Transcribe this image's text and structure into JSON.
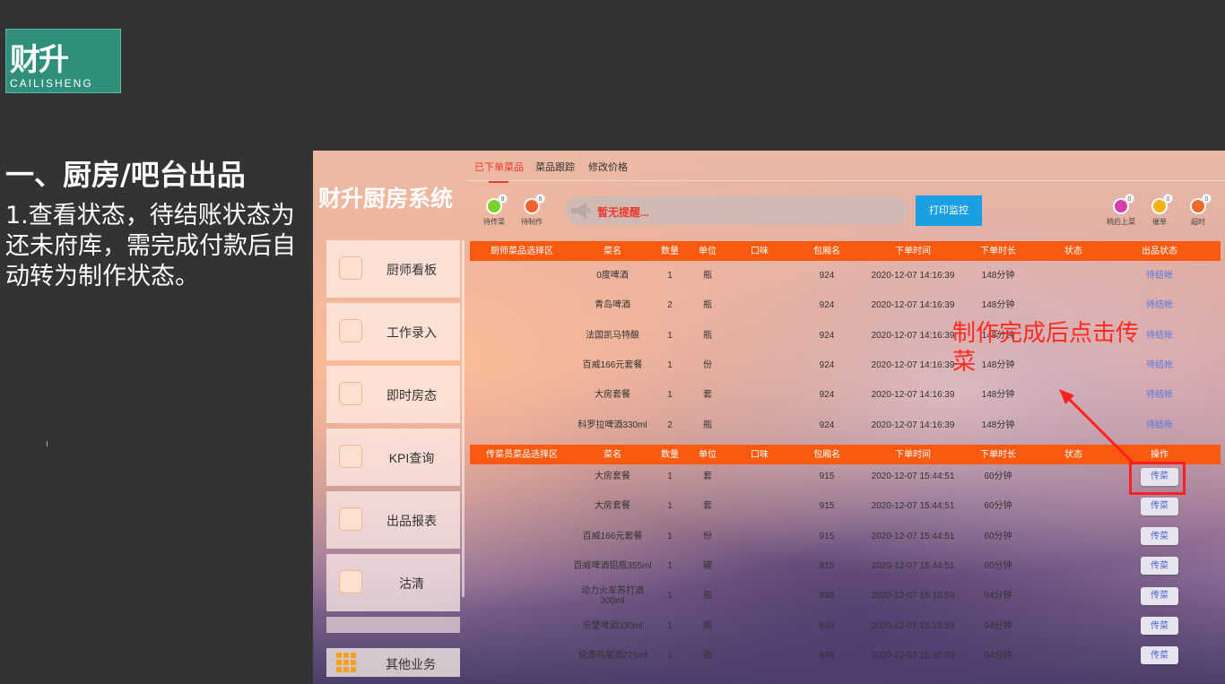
{
  "logo": {
    "main": "财升",
    "sub": "CAILISHENG"
  },
  "slide": {
    "title": "一、厨房/吧台出品",
    "desc": "1.查看状态，待结账状态为还未府库，需完成付款后自动转为制作状态。"
  },
  "app": {
    "title": "财升厨房系统",
    "tabs": [
      "已下单菜品",
      "菜品跟踪",
      "修改价格"
    ],
    "left_stats": [
      {
        "label": "待传菜",
        "count": "9",
        "color": "#7bd02b"
      },
      {
        "label": "待制作",
        "count": "6",
        "color": "#f2622a"
      }
    ],
    "right_stats": [
      {
        "label": "稍后上菜",
        "count": "0",
        "color": "#d53fa9"
      },
      {
        "label": "催单",
        "count": "0",
        "color": "#f5b215"
      },
      {
        "label": "超时",
        "count": "0",
        "color": "#f26a2a"
      }
    ],
    "alert": "暂无提醒...",
    "print_button": "打印监控",
    "sidebar": [
      "厨师看板",
      "工作录入",
      "即时房态",
      "KPI查询",
      "出品报表",
      "沽清"
    ],
    "other": "其他业务"
  },
  "table1": {
    "headers": [
      "厨师菜品选择区",
      "菜名",
      "数量",
      "单位",
      "口味",
      "包厢名",
      "下单时间",
      "下单时长",
      "状态",
      "出品状态"
    ],
    "rows": [
      [
        "",
        "0度啤酒",
        "1",
        "瓶",
        "",
        "924",
        "2020-12-07 14:16:39",
        "148分钟",
        "",
        "待结帐"
      ],
      [
        "",
        "青岛啤酒",
        "2",
        "瓶",
        "",
        "924",
        "2020-12-07 14:16:39",
        "148分钟",
        "",
        "待结帐"
      ],
      [
        "",
        "法国凯马特酿",
        "1",
        "瓶",
        "",
        "924",
        "2020-12-07 14:16:39",
        "148分钟",
        "",
        "待结帐"
      ],
      [
        "",
        "百威166元套餐",
        "1",
        "份",
        "",
        "924",
        "2020-12-07 14:16:39",
        "148分钟",
        "",
        "待结帐"
      ],
      [
        "",
        "大房套餐",
        "1",
        "套",
        "",
        "924",
        "2020-12-07 14:16:39",
        "148分钟",
        "",
        "待结帐"
      ],
      [
        "",
        "科罗拉啤酒330ml",
        "2",
        "瓶",
        "",
        "924",
        "2020-12-07 14:16:39",
        "148分钟",
        "",
        "待结帐"
      ]
    ]
  },
  "table2": {
    "headers": [
      "传菜员菜品选择区",
      "菜名",
      "数量",
      "单位",
      "口味",
      "包厢名",
      "下单时间",
      "下单时长",
      "状态",
      "操作"
    ],
    "action": "传菜",
    "rows": [
      [
        "",
        "大房套餐",
        "1",
        "套",
        "",
        "915",
        "2020-12-07 15:44:51",
        "60分钟",
        ""
      ],
      [
        "",
        "大房套餐",
        "1",
        "套",
        "",
        "915",
        "2020-12-07 15:44:51",
        "60分钟",
        ""
      ],
      [
        "",
        "百威166元套餐",
        "1",
        "份",
        "",
        "915",
        "2020-12-07 15:44:51",
        "60分钟",
        ""
      ],
      [
        "",
        "百威啤酒铝瓶355ml",
        "1",
        "罐",
        "",
        "915",
        "2020-12-07 15:44:51",
        "60分钟",
        ""
      ],
      [
        "",
        "动力火车苏打酒300ml",
        "1",
        "瓶",
        "",
        "898",
        "2020-12-07 15:10:59",
        "94分钟",
        ""
      ],
      [
        "",
        "乐堡啤酒330ml",
        "1",
        "瓶",
        "",
        "898",
        "2020-12-07 15:10:59",
        "94分钟",
        ""
      ],
      [
        "",
        "锐澳鸡尾酒275ml",
        "1",
        "瓶",
        "",
        "898",
        "2020-12-07 15:10:59",
        "94分钟",
        ""
      ]
    ]
  },
  "annotation": "制作完成后点击传菜"
}
